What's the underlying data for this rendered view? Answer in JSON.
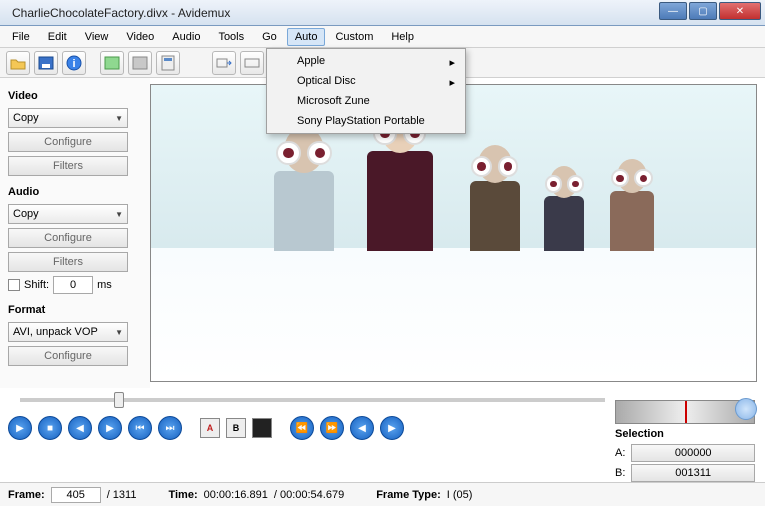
{
  "window": {
    "title": "CharlieChocolateFactory.divx - Avidemux"
  },
  "menubar": [
    "File",
    "Edit",
    "View",
    "Video",
    "Audio",
    "Tools",
    "Go",
    "Auto",
    "Custom",
    "Help"
  ],
  "menu_active_index": 7,
  "dropdown": {
    "items": [
      {
        "label": "Apple",
        "submenu": true
      },
      {
        "label": "Optical Disc",
        "submenu": true
      },
      {
        "label": "Microsoft Zune",
        "submenu": false
      },
      {
        "label": "Sony PlayStation Portable",
        "submenu": false
      }
    ]
  },
  "sidebar": {
    "video": {
      "heading": "Video",
      "codec": "Copy",
      "configure": "Configure",
      "filters": "Filters"
    },
    "audio": {
      "heading": "Audio",
      "codec": "Copy",
      "configure": "Configure",
      "filters": "Filters",
      "shift_label": "Shift:",
      "shift_value": "0",
      "shift_unit": "ms"
    },
    "format": {
      "heading": "Format",
      "container": "AVI, unpack VOP",
      "configure": "Configure"
    }
  },
  "selection": {
    "heading": "Selection",
    "a_label": "A:",
    "a_value": "000000",
    "b_label": "B:",
    "b_value": "001311"
  },
  "status": {
    "frame_label": "Frame:",
    "frame_current": "405",
    "frame_total": "/ 1311",
    "time_label": "Time:",
    "time_current": "00:00:16.891",
    "time_total": "/ 00:00:54.679",
    "frametype_label": "Frame Type:",
    "frametype_value": "I (05)"
  }
}
